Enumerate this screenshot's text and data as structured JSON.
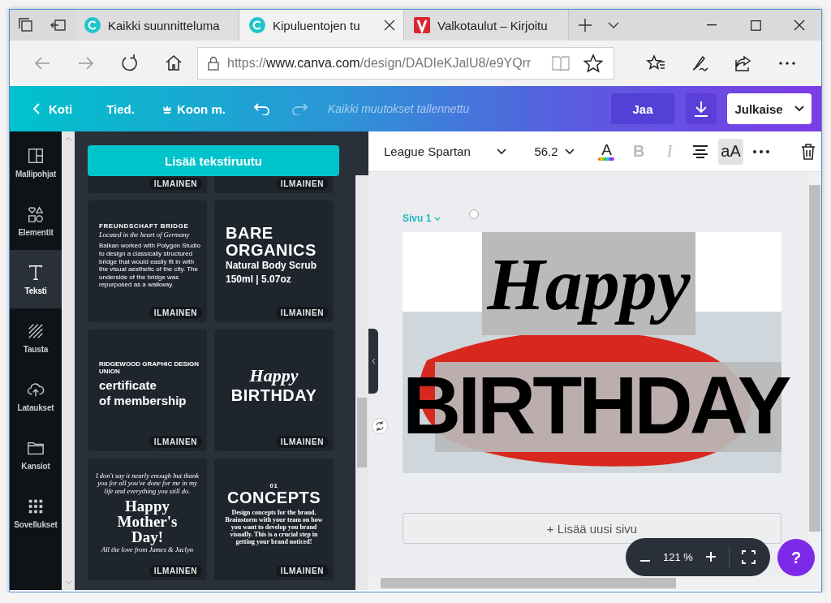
{
  "browser": {
    "tabs": [
      {
        "title": "Kaikki suunnitteluma",
        "kind": "canva",
        "selected": false
      },
      {
        "title": "Kipuluentojen tu",
        "kind": "canva",
        "selected": true
      },
      {
        "title": "Valkotaulut – Kirjoitu",
        "kind": "v",
        "selected": false
      }
    ],
    "url": {
      "scheme": "https://",
      "domain": "www.canva.com",
      "path": "/design/DADIeKJalU8/e9YQrr"
    }
  },
  "topbar": {
    "home": "Koti",
    "file": "Tied.",
    "resize": "Koon m.",
    "status": "Kaikki muutokset tallennettu",
    "share": "Jaa",
    "publish": "Julkaise"
  },
  "rail": [
    {
      "label": "Mallipohjat",
      "kind": "layout",
      "selected": false
    },
    {
      "label": "Elementit",
      "kind": "shapes",
      "selected": false
    },
    {
      "label": "Teksti",
      "kind": "text",
      "selected": true
    },
    {
      "label": "Tausta",
      "kind": "hatch",
      "selected": false
    },
    {
      "label": "Lataukset",
      "kind": "upload",
      "selected": false
    },
    {
      "label": "Kansiot",
      "kind": "folder",
      "selected": false
    },
    {
      "label": "Sovellukset",
      "kind": "apps",
      "selected": false
    }
  ],
  "panel": {
    "add_button": "Lisää tekstiruutu",
    "templates": [
      {
        "kind": "cropped",
        "badge": "ILMAINEN"
      },
      {
        "kind": "cropped",
        "badge": "ILMAINEN"
      },
      {
        "kind": "left",
        "lines": [
          {
            "text": "FREUNDSCHAFT BRIDGE",
            "kind": "caps-small"
          },
          {
            "text": "Located in the heart of Germany",
            "kind": "italic-tiny"
          },
          {
            "text": "Balkan worked with Polygon Studio to design a classically structured bridge that would easily fit in with the visual aesthetic of the city. The underside of the bridge was repurposed as a walkway.",
            "kind": "body-tiny"
          }
        ],
        "badge": "ILMAINEN"
      },
      {
        "kind": "left",
        "lines": [
          {
            "text": "BARE",
            "kind": "display-sans"
          },
          {
            "text": "ORGANICS",
            "kind": "display-sans"
          },
          {
            "text": "Natural Body Scrub",
            "kind": "sans-medium"
          },
          {
            "text": "150ml | 5.07oz",
            "kind": "sans-medium"
          }
        ],
        "badge": "ILMAINEN"
      },
      {
        "kind": "left",
        "lines": [
          {
            "text": "RIDGEWOOD GRAPHIC DESIGN UNION",
            "kind": "caps-tiny"
          },
          {
            "text": "certificate",
            "kind": "rounded-medium"
          },
          {
            "text": "of membership",
            "kind": "rounded-medium"
          }
        ],
        "badge": "ILMAINEN"
      },
      {
        "kind": "center",
        "lines": [
          {
            "text": "Happy",
            "kind": "script"
          },
          {
            "text": "BIRTHDAY",
            "kind": "display-sans"
          }
        ],
        "badge": "ILMAINEN"
      },
      {
        "kind": "center",
        "lines": [
          {
            "text": "I don't say it nearly enough but thank you for all you've done for me in my life and everything you still do.",
            "kind": "italic-tiny"
          },
          {
            "text": "Happy",
            "kind": "serif-display"
          },
          {
            "text": "Mother's",
            "kind": "serif-display"
          },
          {
            "text": "Day!",
            "kind": "serif-display"
          },
          {
            "text": "All the love from James & Jaclyn",
            "kind": "italic-tiny"
          }
        ],
        "badge": "ILMAINEN"
      },
      {
        "kind": "center",
        "lines": [
          {
            "text": "01",
            "kind": "caps-small"
          },
          {
            "text": "CONCEPTS",
            "kind": "display-sans"
          },
          {
            "text": "Design concepts for the brand. Brainstorm with your team on how you want to develop you brand visually. This is a crucial step in getting your brand noticed!",
            "kind": "serif-tiny"
          }
        ],
        "badge": "ILMAINEN"
      }
    ]
  },
  "toolbar": {
    "font": "League Spartan",
    "size": "56.2",
    "color_glyph": "A",
    "bold": {
      "glyph": "B",
      "disabled": true
    },
    "italic": {
      "glyph": "I",
      "disabled": true
    },
    "case": {
      "glyph": "aA",
      "selected": true
    }
  },
  "canvas": {
    "page_label": "Sivu 1",
    "design_texts": [
      {
        "text": "Happy",
        "kind": "script"
      },
      {
        "text": "BIRTHDAY",
        "kind": "display"
      }
    ],
    "add_page": "+ Lisää uusi sivu",
    "zoom": "121 %",
    "help": "?"
  }
}
